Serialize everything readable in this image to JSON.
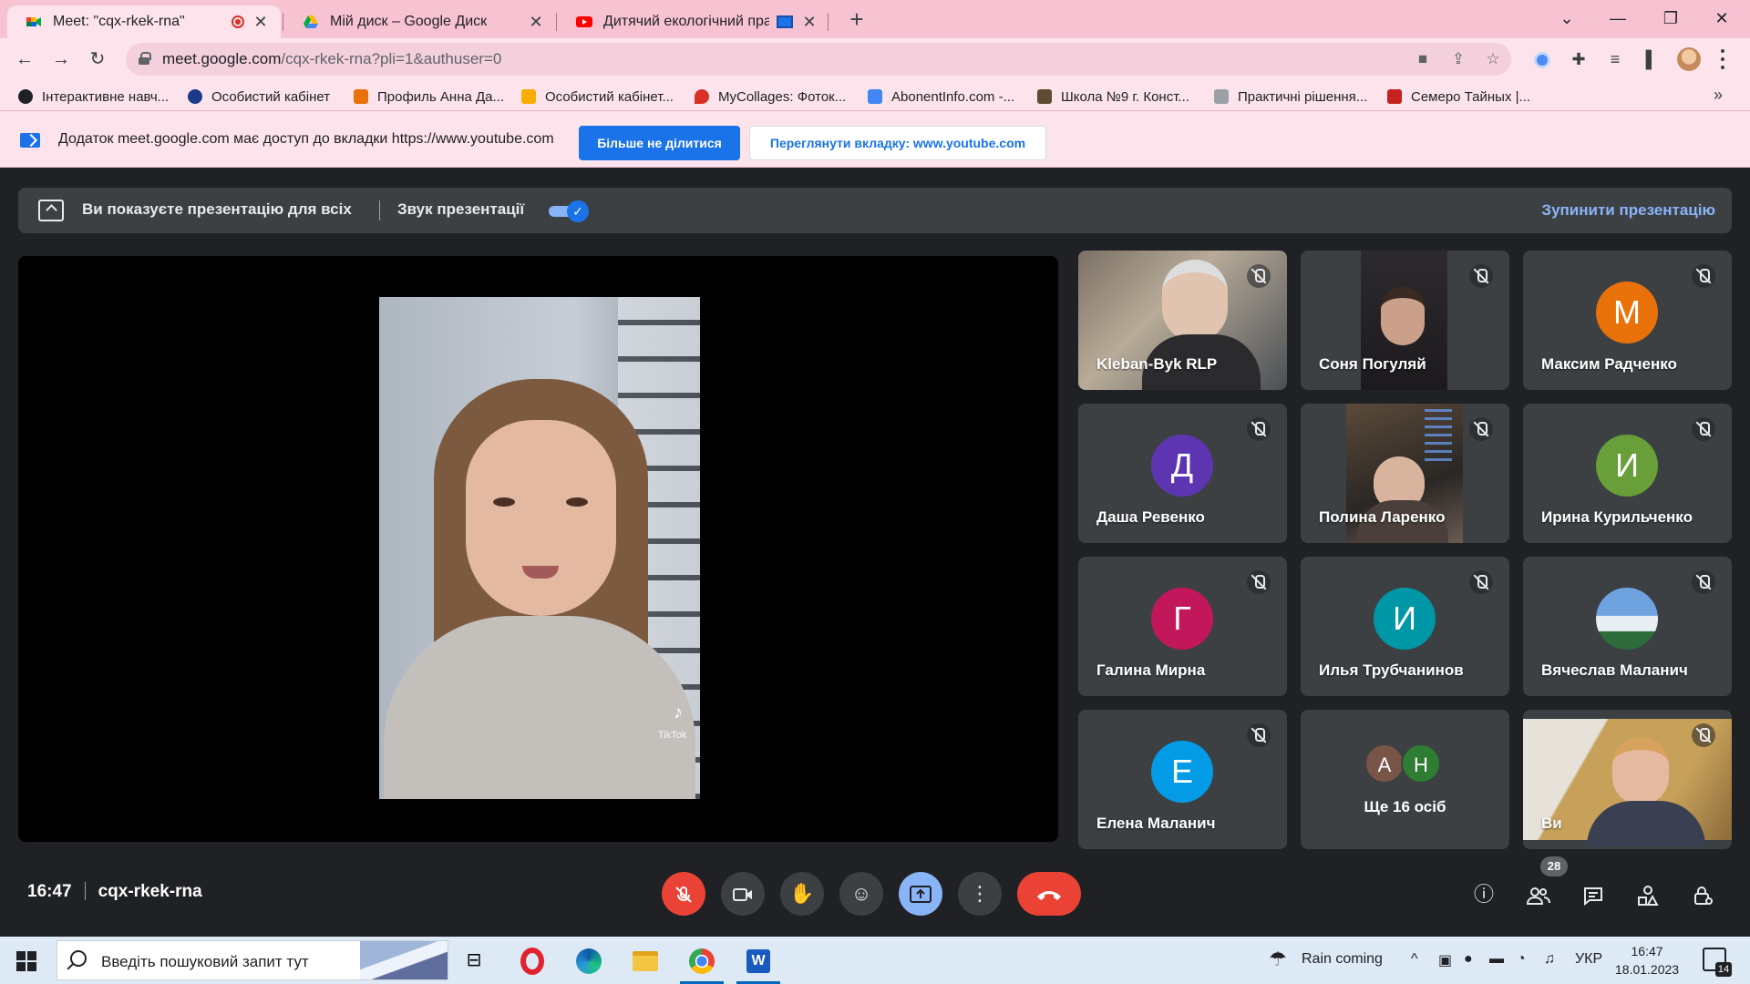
{
  "browser": {
    "tabs": [
      {
        "title": "Meet: \"cqx-rkek-rna\"",
        "active": true
      },
      {
        "title": "Мій диск – Google Диск",
        "active": false
      },
      {
        "title": "Дитячий екологічний прар",
        "active": false
      }
    ],
    "new_tab_label": "+",
    "address": {
      "host": "meet.google.com",
      "path": "/cqx-rkek-rna?pli=1&authuser=0"
    },
    "bookmarks": [
      {
        "label": "Інтерактивне навч...",
        "color": "#202124"
      },
      {
        "label": "Особистий кабінет",
        "color": "#1b3a8a"
      },
      {
        "label": "Профиль Анна Да...",
        "color": "#e8710a"
      },
      {
        "label": "Особистий кабінет...",
        "color": "#f9ab00"
      },
      {
        "label": "MyCollages: Фоток...",
        "color": "#d93025"
      },
      {
        "label": "AbonentInfo.com -...",
        "color": "#4285f4"
      },
      {
        "label": "Школа №9 г. Конст...",
        "color": "#5f4b32"
      },
      {
        "label": "Практичні рішення...",
        "color": "#9aa0a6"
      },
      {
        "label": "Семеро Тайных |...",
        "color": "#c5221f"
      }
    ]
  },
  "share_infobar": {
    "text": "Додаток meet.google.com має доступ до вкладки https://www.youtube.com",
    "stop_sharing_label": "Більше не ділитися",
    "view_tab_label": "Переглянути вкладку: www.youtube.com"
  },
  "meet": {
    "presenting_text": "Ви показуєте презентацію для всіх",
    "presentation_audio_label": "Звук презентації",
    "presentation_audio_on": true,
    "stop_presenting_label": "Зупинити презентацію",
    "tiktok_label": "TikTok",
    "participants": [
      {
        "name": "Kleban-Byk RLP",
        "initial": "",
        "color": "",
        "muted": true
      },
      {
        "name": "Соня Погуляй",
        "initial": "",
        "color": "",
        "muted": true
      },
      {
        "name": "Максим Радченко",
        "initial": "М",
        "color": "#e8710a",
        "muted": true
      },
      {
        "name": "Даша Ревенко",
        "initial": "Д",
        "color": "#5e35b1",
        "muted": true
      },
      {
        "name": "Полина Ларенко",
        "initial": "",
        "color": "",
        "muted": true
      },
      {
        "name": "Ирина Курильченко",
        "initial": "И",
        "color": "#689f38",
        "muted": true
      },
      {
        "name": "Галина Мирна",
        "initial": "Г",
        "color": "#c2185b",
        "muted": true
      },
      {
        "name": "Илья Трубчанинов",
        "initial": "И",
        "color": "#0097a7",
        "muted": true
      },
      {
        "name": "Вячеслав Маланич",
        "initial": "",
        "color": "",
        "muted": true
      },
      {
        "name": "Елена Маланич",
        "initial": "Е",
        "color": "#039be5",
        "muted": true
      }
    ],
    "more": {
      "label": "Ще 16 осіб",
      "avatars": [
        {
          "initial": "А",
          "color": "#795548"
        },
        {
          "initial": "Н",
          "color": "#2e7d32"
        }
      ]
    },
    "self_label": "Ви",
    "time": "16:47",
    "meeting_code": "cqx-rkek-rna",
    "people_count": "28"
  },
  "taskbar": {
    "search_placeholder": "Введіть пошуковий запит тут",
    "weather": "Rain coming",
    "language": "УКР",
    "time": "16:47",
    "date": "18.01.2023",
    "notifications": "14"
  }
}
